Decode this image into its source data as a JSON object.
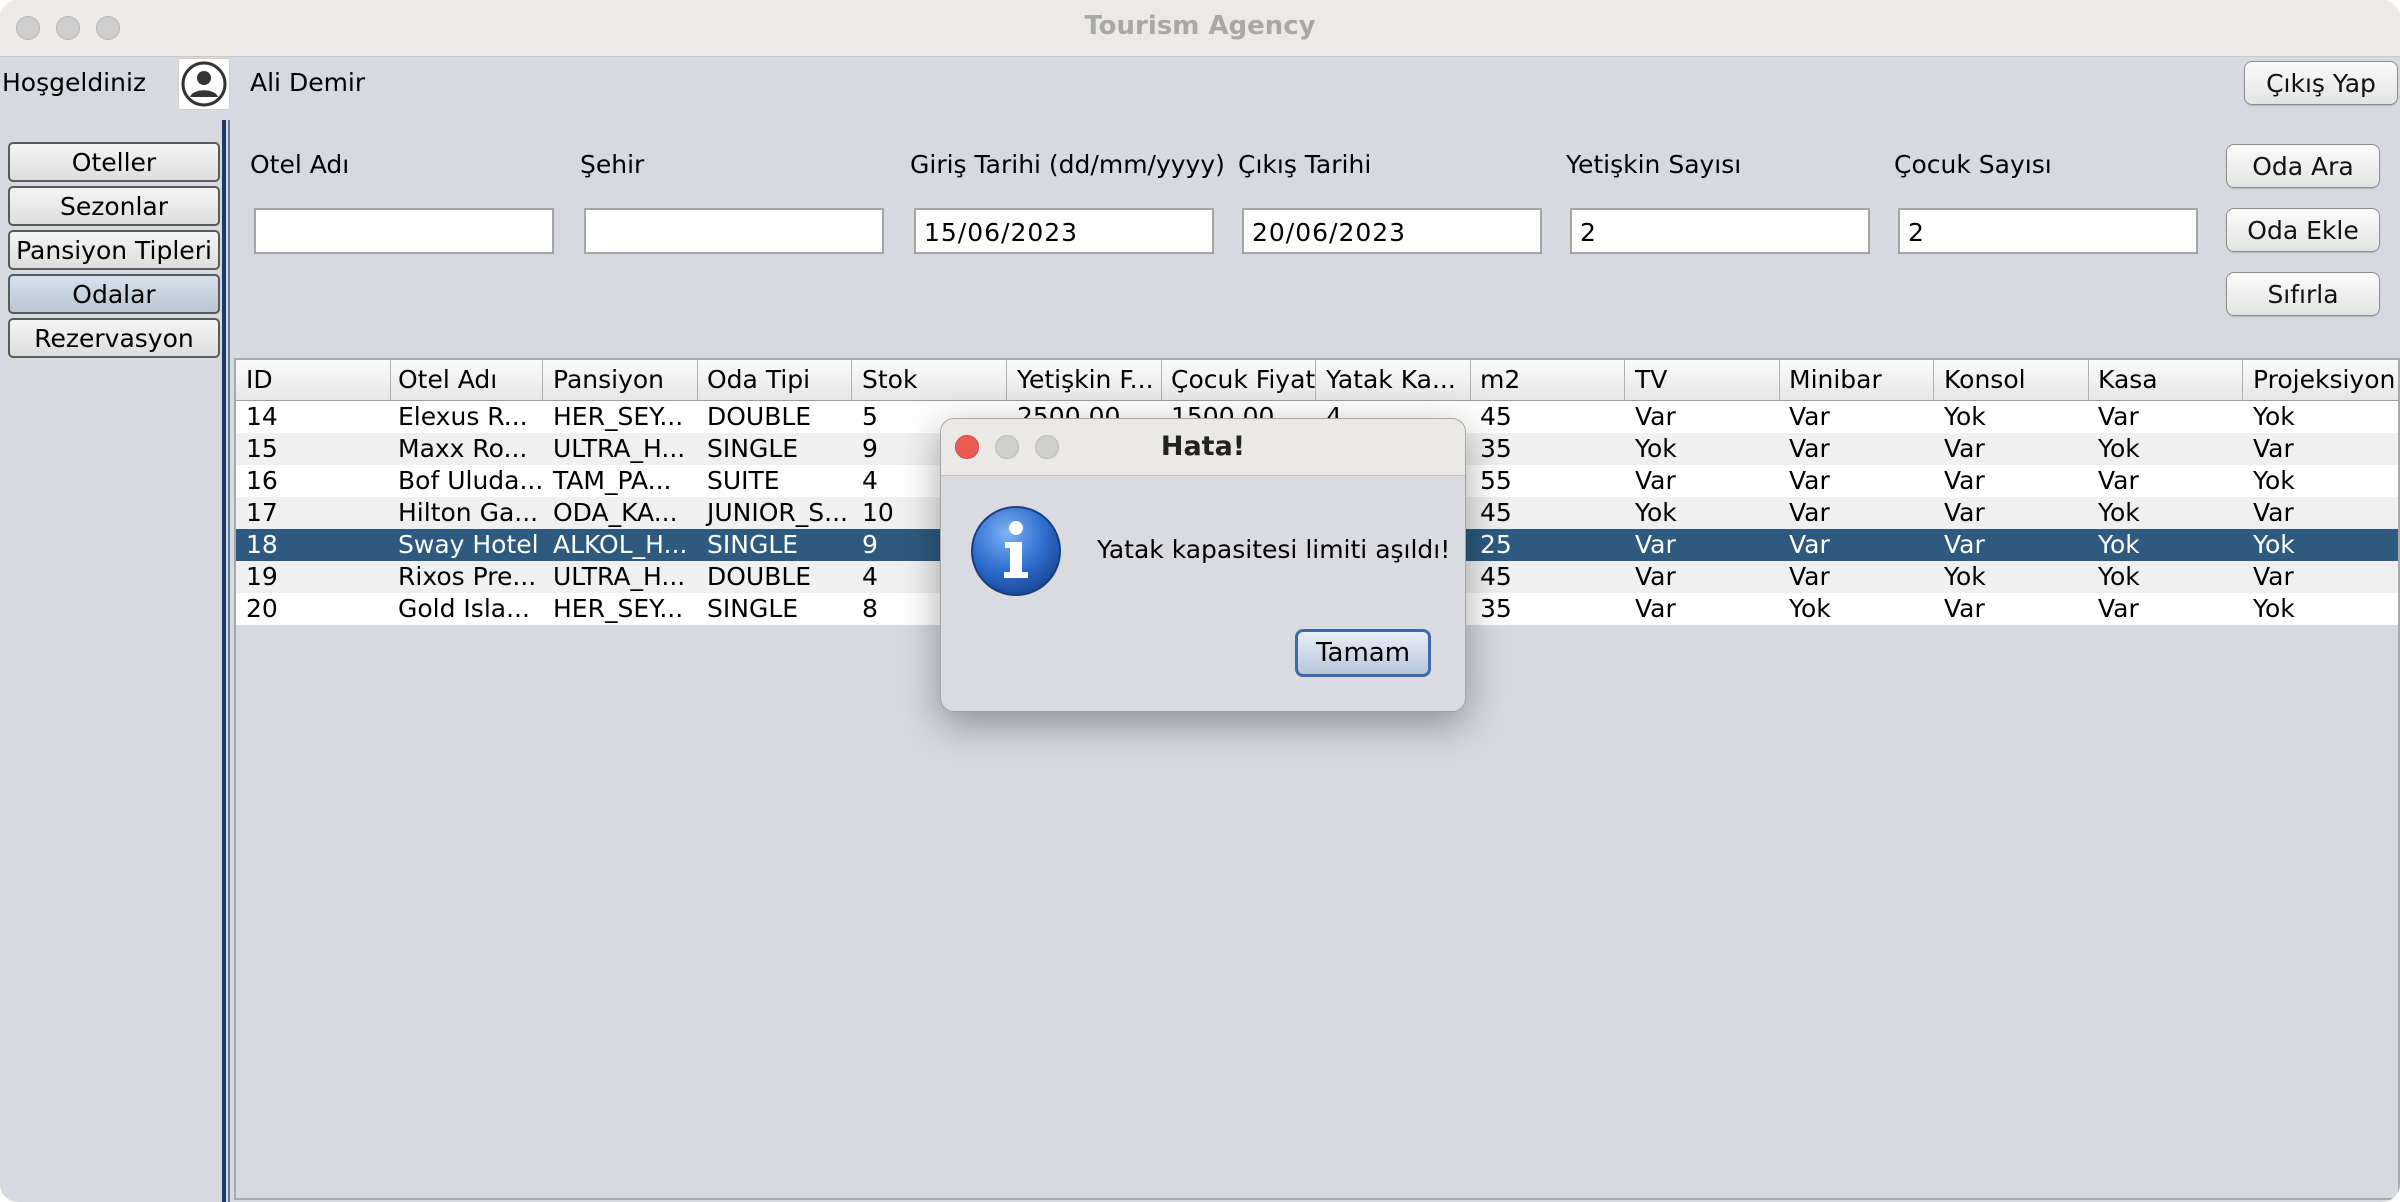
{
  "window": {
    "title": "Tourism Agency"
  },
  "header": {
    "welcome": "Hoşgeldiniz",
    "user_name": "Ali Demir",
    "logout_label": "Çıkış Yap"
  },
  "sidebar": {
    "items": [
      {
        "label": "Oteller"
      },
      {
        "label": "Sezonlar"
      },
      {
        "label": "Pansiyon Tipleri"
      },
      {
        "label": "Odalar"
      },
      {
        "label": "Rezervasyon"
      }
    ]
  },
  "search": {
    "hotel_label": "Otel Adı",
    "city_label": "Şehir",
    "checkin_label": "Giriş Tarihi (dd/mm/yyyy)",
    "checkout_label": "Çıkış Tarihi",
    "adult_label": "Yetişkin Sayısı",
    "child_label": "Çocuk Sayısı",
    "hotel_value": "",
    "city_value": "",
    "checkin_value": "15/06/2023",
    "checkout_value": "20/06/2023",
    "adult_value": "2",
    "child_value": "2",
    "search_button": "Oda Ara",
    "add_button": "Oda Ekle",
    "reset_button": "Sıfırla"
  },
  "table": {
    "columns": [
      "ID",
      "Otel Adı",
      "Pansiyon",
      "Oda Tipi",
      "Stok",
      "Yetişkin F...",
      "Çocuk Fiyat",
      "Yatak Ka...",
      "m2",
      "TV",
      "Minibar",
      "Konsol",
      "Kasa",
      "Projeksiyon"
    ],
    "selected_index": 4,
    "rows": [
      [
        "14",
        "Elexus R...",
        "HER_SEY...",
        "DOUBLE",
        "5",
        "2500.00",
        "1500.00",
        "4",
        "45",
        "Var",
        "Var",
        "Yok",
        "Var",
        "Yok"
      ],
      [
        "15",
        "Maxx Ro...",
        "ULTRA_H...",
        "SINGLE",
        "9",
        "",
        "",
        "",
        "35",
        "Yok",
        "Var",
        "Var",
        "Yok",
        "Var"
      ],
      [
        "16",
        "Bof Uluda...",
        "TAM_PA...",
        "SUITE",
        "4",
        "",
        "",
        "",
        "55",
        "Var",
        "Var",
        "Var",
        "Var",
        "Yok"
      ],
      [
        "17",
        "Hilton Ga...",
        "ODA_KA...",
        "JUNIOR_S...",
        "10",
        "",
        "",
        "",
        "45",
        "Yok",
        "Var",
        "Var",
        "Yok",
        "Var"
      ],
      [
        "18",
        "Sway Hotel",
        "ALKOL_H...",
        "SINGLE",
        "9",
        "",
        "",
        "",
        "25",
        "Var",
        "Var",
        "Var",
        "Yok",
        "Yok"
      ],
      [
        "19",
        "Rixos Pre...",
        "ULTRA_H...",
        "DOUBLE",
        "4",
        "",
        "",
        "",
        "45",
        "Var",
        "Var",
        "Yok",
        "Yok",
        "Var"
      ],
      [
        "20",
        "Gold Isla...",
        "HER_SEY...",
        "SINGLE",
        "8",
        "",
        "",
        "",
        "35",
        "Var",
        "Yok",
        "Var",
        "Var",
        "Yok"
      ]
    ]
  },
  "dialog": {
    "title": "Hata!",
    "message": "Yatak kapasitesi limiti aşıldı!",
    "ok_label": "Tamam",
    "icon": "info-icon"
  }
}
